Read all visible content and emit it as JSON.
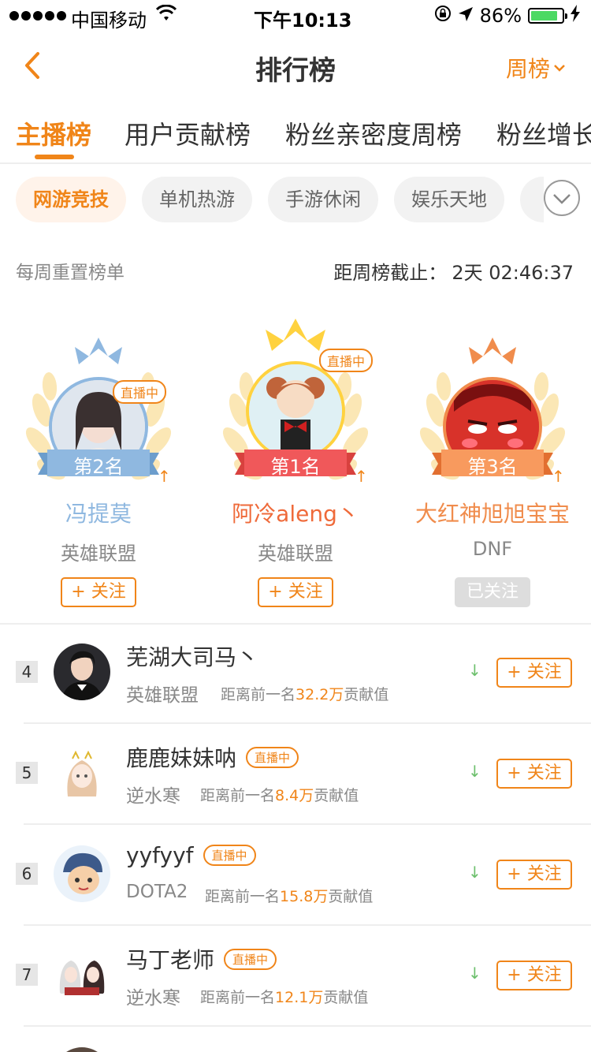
{
  "status_bar": {
    "carrier": "中国移动",
    "time": "下午10:13",
    "battery": "86%",
    "battery_level": 0.86
  },
  "nav": {
    "title": "排行榜",
    "period": "周榜"
  },
  "tabs": [
    "主播榜",
    "用户贡献榜",
    "粉丝亲密度周榜",
    "粉丝增长"
  ],
  "categories": [
    "网游竞技",
    "单机热游",
    "手游休闲",
    "娱乐天地"
  ],
  "info": {
    "weekly_reset": "每周重置榜单",
    "countdown_label": "距周榜截止：",
    "countdown_value": "2天 02:46:37"
  },
  "podium": [
    {
      "rank": "第2名",
      "name": "冯提莫",
      "game": "英雄联盟",
      "follow": "+ 关注",
      "live": "直播中",
      "trend": "↑",
      "color": "#8fb8e0"
    },
    {
      "rank": "第1名",
      "name": "阿冷aleng丶",
      "game": "英雄联盟",
      "follow": "+ 关注",
      "live": "直播中",
      "trend": "↑",
      "color": "#ef6a3a"
    },
    {
      "rank": "第3名",
      "name": "大红神旭旭宝宝",
      "game": "DNF",
      "follow": "已关注",
      "live": "",
      "trend": "↑",
      "color": "#f08c4c"
    }
  ],
  "list": [
    {
      "rank": "4",
      "name": "芜湖大司马丶",
      "live": "",
      "game": "英雄联盟",
      "gap_prefix": "距离前一名",
      "gap_value": "32.2万",
      "gap_suffix": "贡献值",
      "trend": "↓",
      "follow": "+ 关注"
    },
    {
      "rank": "5",
      "name": "鹿鹿妹妹呐",
      "live": "直播中",
      "game": "逆水寒",
      "gap_prefix": "距离前一名",
      "gap_value": "8.4万",
      "gap_suffix": "贡献值",
      "trend": "↓",
      "follow": "+ 关注"
    },
    {
      "rank": "6",
      "name": "yyfyyf",
      "live": "直播中",
      "game": "DOTA2",
      "gap_prefix": "距离前一名",
      "gap_value": "15.8万",
      "gap_suffix": "贡献值",
      "trend": "↓",
      "follow": "+ 关注"
    },
    {
      "rank": "7",
      "name": "马丁老师",
      "live": "直播中",
      "game": "逆水寒",
      "gap_prefix": "距离前一名",
      "gap_value": "12.1万",
      "gap_suffix": "贡献值",
      "trend": "↓",
      "follow": "+ 关注"
    }
  ]
}
